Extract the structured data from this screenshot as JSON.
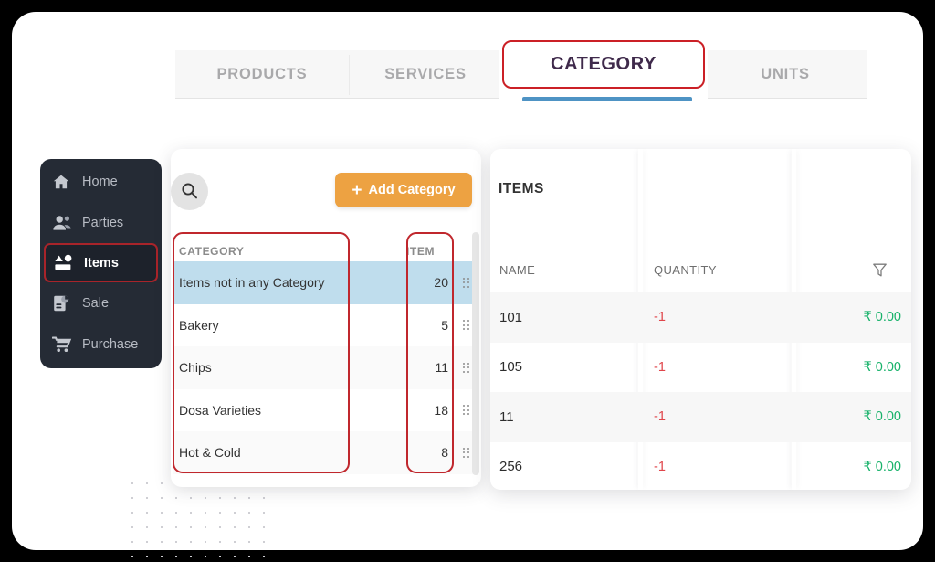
{
  "tabs": [
    {
      "label": "PRODUCTS",
      "active": false
    },
    {
      "label": "SERVICES",
      "active": false
    },
    {
      "label": "CATEGORY",
      "active": true
    },
    {
      "label": "UNITS",
      "active": false
    }
  ],
  "sidebar": {
    "items": [
      {
        "label": "Home",
        "icon": "home-icon",
        "active": false
      },
      {
        "label": "Parties",
        "icon": "users-icon",
        "active": false
      },
      {
        "label": "Items",
        "icon": "items-icon",
        "active": true
      },
      {
        "label": "Sale",
        "icon": "sale-icon",
        "active": false
      },
      {
        "label": "Purchase",
        "icon": "cart-icon",
        "active": false
      }
    ]
  },
  "category_panel": {
    "search_icon": "search-icon",
    "add_button_label": "Add Category",
    "add_button_plus": "+",
    "columns": {
      "category": "CATEGORY",
      "item": "ITEM"
    },
    "rows": [
      {
        "name": "Items not in any Category",
        "count": "20",
        "selected": true
      },
      {
        "name": "Bakery",
        "count": "5",
        "selected": false
      },
      {
        "name": "Chips",
        "count": "11",
        "selected": false
      },
      {
        "name": "Dosa Varieties",
        "count": "18",
        "selected": false
      },
      {
        "name": "Hot & Cold",
        "count": "8",
        "selected": false
      }
    ]
  },
  "items_panel": {
    "title": "ITEMS",
    "columns": {
      "name": "NAME",
      "quantity": "QUANTITY",
      "filter_icon": "filter-icon"
    },
    "rows": [
      {
        "name": "101",
        "quantity": "-1",
        "amount": "₹ 0.00"
      },
      {
        "name": "105",
        "quantity": "-1",
        "amount": "₹ 0.00"
      },
      {
        "name": "11",
        "quantity": "-1",
        "amount": "₹ 0.00"
      },
      {
        "name": "256",
        "quantity": "-1",
        "amount": "₹ 0.00"
      }
    ]
  },
  "colors": {
    "accent_orange": "#eda242",
    "annotation_red": "#c0272d",
    "active_tab_text": "#3f2a4b",
    "tab_underline_blue": "#4e93c4",
    "selected_row_blue": "#bfdded",
    "quantity_negative": "#e0454b",
    "amount_positive": "#17b26a",
    "sidebar_bg": "#252b35"
  }
}
